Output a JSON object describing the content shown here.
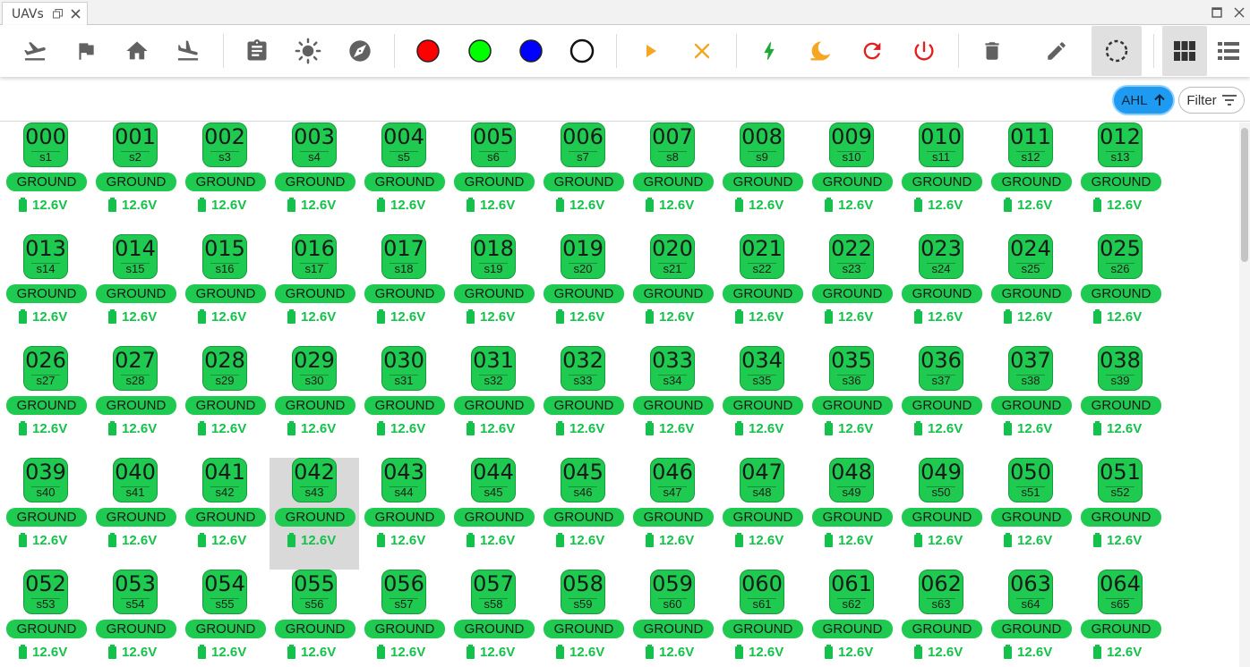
{
  "window": {
    "tab_title": "UAVs"
  },
  "toolbar": {
    "buttons": [
      {
        "name": "takeoff-button",
        "icon": "takeoff-icon"
      },
      {
        "name": "waypoint-button",
        "icon": "flag-icon"
      },
      {
        "name": "return-home-button",
        "icon": "home-icon"
      },
      {
        "name": "land-button",
        "icon": "landing-icon"
      },
      {
        "name": "show-details-button",
        "icon": "clipboard-icon"
      },
      {
        "name": "lights-button",
        "icon": "sun-icon"
      },
      {
        "name": "compass-button",
        "icon": "compass-icon"
      },
      {
        "name": "color-red-button",
        "icon": "red-circle-icon"
      },
      {
        "name": "color-green-button",
        "icon": "green-circle-icon"
      },
      {
        "name": "color-blue-button",
        "icon": "blue-circle-icon"
      },
      {
        "name": "color-off-button",
        "icon": "empty-circle-icon"
      },
      {
        "name": "start-button",
        "icon": "play-icon"
      },
      {
        "name": "stop-button",
        "icon": "close-icon"
      },
      {
        "name": "power-on-button",
        "icon": "bolt-icon"
      },
      {
        "name": "sleep-button",
        "icon": "moon-icon"
      },
      {
        "name": "reboot-button",
        "icon": "refresh-icon"
      },
      {
        "name": "shutdown-button",
        "icon": "power-icon"
      },
      {
        "name": "delete-button",
        "icon": "trash-icon"
      },
      {
        "name": "edit-button",
        "icon": "pencil-icon"
      },
      {
        "name": "select-all-button",
        "icon": "dashed-circle-icon",
        "active": true
      },
      {
        "name": "grid-view-button",
        "icon": "grid-icon",
        "active": true
      },
      {
        "name": "list-view-button",
        "icon": "list-icon"
      }
    ],
    "colors": {
      "red": "#ff0000",
      "green": "#00ff00",
      "blue": "#0000ff",
      "orange": "#f5a623",
      "bolt": "#1ea836",
      "refresh": "#e02020"
    }
  },
  "sort_chip": {
    "label": "AHL"
  },
  "filter_chip": {
    "label": "Filter"
  },
  "uav_grid": {
    "status_color": "#1fca50",
    "battery_color": "#14c14a",
    "selected_id": "042",
    "items": [
      {
        "id": "000",
        "sub": "s1",
        "status": "GROUND",
        "battery": "12.6V"
      },
      {
        "id": "001",
        "sub": "s2",
        "status": "GROUND",
        "battery": "12.6V"
      },
      {
        "id": "002",
        "sub": "s3",
        "status": "GROUND",
        "battery": "12.6V"
      },
      {
        "id": "003",
        "sub": "s4",
        "status": "GROUND",
        "battery": "12.6V"
      },
      {
        "id": "004",
        "sub": "s5",
        "status": "GROUND",
        "battery": "12.6V"
      },
      {
        "id": "005",
        "sub": "s6",
        "status": "GROUND",
        "battery": "12.6V"
      },
      {
        "id": "006",
        "sub": "s7",
        "status": "GROUND",
        "battery": "12.6V"
      },
      {
        "id": "007",
        "sub": "s8",
        "status": "GROUND",
        "battery": "12.6V"
      },
      {
        "id": "008",
        "sub": "s9",
        "status": "GROUND",
        "battery": "12.6V"
      },
      {
        "id": "009",
        "sub": "s10",
        "status": "GROUND",
        "battery": "12.6V"
      },
      {
        "id": "010",
        "sub": "s11",
        "status": "GROUND",
        "battery": "12.6V"
      },
      {
        "id": "011",
        "sub": "s12",
        "status": "GROUND",
        "battery": "12.6V"
      },
      {
        "id": "012",
        "sub": "s13",
        "status": "GROUND",
        "battery": "12.6V"
      },
      {
        "id": "013",
        "sub": "s14",
        "status": "GROUND",
        "battery": "12.6V"
      },
      {
        "id": "014",
        "sub": "s15",
        "status": "GROUND",
        "battery": "12.6V"
      },
      {
        "id": "015",
        "sub": "s16",
        "status": "GROUND",
        "battery": "12.6V"
      },
      {
        "id": "016",
        "sub": "s17",
        "status": "GROUND",
        "battery": "12.6V"
      },
      {
        "id": "017",
        "sub": "s18",
        "status": "GROUND",
        "battery": "12.6V"
      },
      {
        "id": "018",
        "sub": "s19",
        "status": "GROUND",
        "battery": "12.6V"
      },
      {
        "id": "019",
        "sub": "s20",
        "status": "GROUND",
        "battery": "12.6V"
      },
      {
        "id": "020",
        "sub": "s21",
        "status": "GROUND",
        "battery": "12.6V"
      },
      {
        "id": "021",
        "sub": "s22",
        "status": "GROUND",
        "battery": "12.6V"
      },
      {
        "id": "022",
        "sub": "s23",
        "status": "GROUND",
        "battery": "12.6V"
      },
      {
        "id": "023",
        "sub": "s24",
        "status": "GROUND",
        "battery": "12.6V"
      },
      {
        "id": "024",
        "sub": "s25",
        "status": "GROUND",
        "battery": "12.6V"
      },
      {
        "id": "025",
        "sub": "s26",
        "status": "GROUND",
        "battery": "12.6V"
      },
      {
        "id": "026",
        "sub": "s27",
        "status": "GROUND",
        "battery": "12.6V"
      },
      {
        "id": "027",
        "sub": "s28",
        "status": "GROUND",
        "battery": "12.6V"
      },
      {
        "id": "028",
        "sub": "s29",
        "status": "GROUND",
        "battery": "12.6V"
      },
      {
        "id": "029",
        "sub": "s30",
        "status": "GROUND",
        "battery": "12.6V"
      },
      {
        "id": "030",
        "sub": "s31",
        "status": "GROUND",
        "battery": "12.6V"
      },
      {
        "id": "031",
        "sub": "s32",
        "status": "GROUND",
        "battery": "12.6V"
      },
      {
        "id": "032",
        "sub": "s33",
        "status": "GROUND",
        "battery": "12.6V"
      },
      {
        "id": "033",
        "sub": "s34",
        "status": "GROUND",
        "battery": "12.6V"
      },
      {
        "id": "034",
        "sub": "s35",
        "status": "GROUND",
        "battery": "12.6V"
      },
      {
        "id": "035",
        "sub": "s36",
        "status": "GROUND",
        "battery": "12.6V"
      },
      {
        "id": "036",
        "sub": "s37",
        "status": "GROUND",
        "battery": "12.6V"
      },
      {
        "id": "037",
        "sub": "s38",
        "status": "GROUND",
        "battery": "12.6V"
      },
      {
        "id": "038",
        "sub": "s39",
        "status": "GROUND",
        "battery": "12.6V"
      },
      {
        "id": "039",
        "sub": "s40",
        "status": "GROUND",
        "battery": "12.6V"
      },
      {
        "id": "040",
        "sub": "s41",
        "status": "GROUND",
        "battery": "12.6V"
      },
      {
        "id": "041",
        "sub": "s42",
        "status": "GROUND",
        "battery": "12.6V"
      },
      {
        "id": "042",
        "sub": "s43",
        "status": "GROUND",
        "battery": "12.6V"
      },
      {
        "id": "043",
        "sub": "s44",
        "status": "GROUND",
        "battery": "12.6V"
      },
      {
        "id": "044",
        "sub": "s45",
        "status": "GROUND",
        "battery": "12.6V"
      },
      {
        "id": "045",
        "sub": "s46",
        "status": "GROUND",
        "battery": "12.6V"
      },
      {
        "id": "046",
        "sub": "s47",
        "status": "GROUND",
        "battery": "12.6V"
      },
      {
        "id": "047",
        "sub": "s48",
        "status": "GROUND",
        "battery": "12.6V"
      },
      {
        "id": "048",
        "sub": "s49",
        "status": "GROUND",
        "battery": "12.6V"
      },
      {
        "id": "049",
        "sub": "s50",
        "status": "GROUND",
        "battery": "12.6V"
      },
      {
        "id": "050",
        "sub": "s51",
        "status": "GROUND",
        "battery": "12.6V"
      },
      {
        "id": "051",
        "sub": "s52",
        "status": "GROUND",
        "battery": "12.6V"
      },
      {
        "id": "052",
        "sub": "s53",
        "status": "GROUND",
        "battery": "12.6V"
      },
      {
        "id": "053",
        "sub": "s54",
        "status": "GROUND",
        "battery": "12.6V"
      },
      {
        "id": "054",
        "sub": "s55",
        "status": "GROUND",
        "battery": "12.6V"
      },
      {
        "id": "055",
        "sub": "s56",
        "status": "GROUND",
        "battery": "12.6V"
      },
      {
        "id": "056",
        "sub": "s57",
        "status": "GROUND",
        "battery": "12.6V"
      },
      {
        "id": "057",
        "sub": "s58",
        "status": "GROUND",
        "battery": "12.6V"
      },
      {
        "id": "058",
        "sub": "s59",
        "status": "GROUND",
        "battery": "12.6V"
      },
      {
        "id": "059",
        "sub": "s60",
        "status": "GROUND",
        "battery": "12.6V"
      },
      {
        "id": "060",
        "sub": "s61",
        "status": "GROUND",
        "battery": "12.6V"
      },
      {
        "id": "061",
        "sub": "s62",
        "status": "GROUND",
        "battery": "12.6V"
      },
      {
        "id": "062",
        "sub": "s63",
        "status": "GROUND",
        "battery": "12.6V"
      },
      {
        "id": "063",
        "sub": "s64",
        "status": "GROUND",
        "battery": "12.6V"
      },
      {
        "id": "064",
        "sub": "s65",
        "status": "GROUND",
        "battery": "12.6V"
      }
    ]
  }
}
